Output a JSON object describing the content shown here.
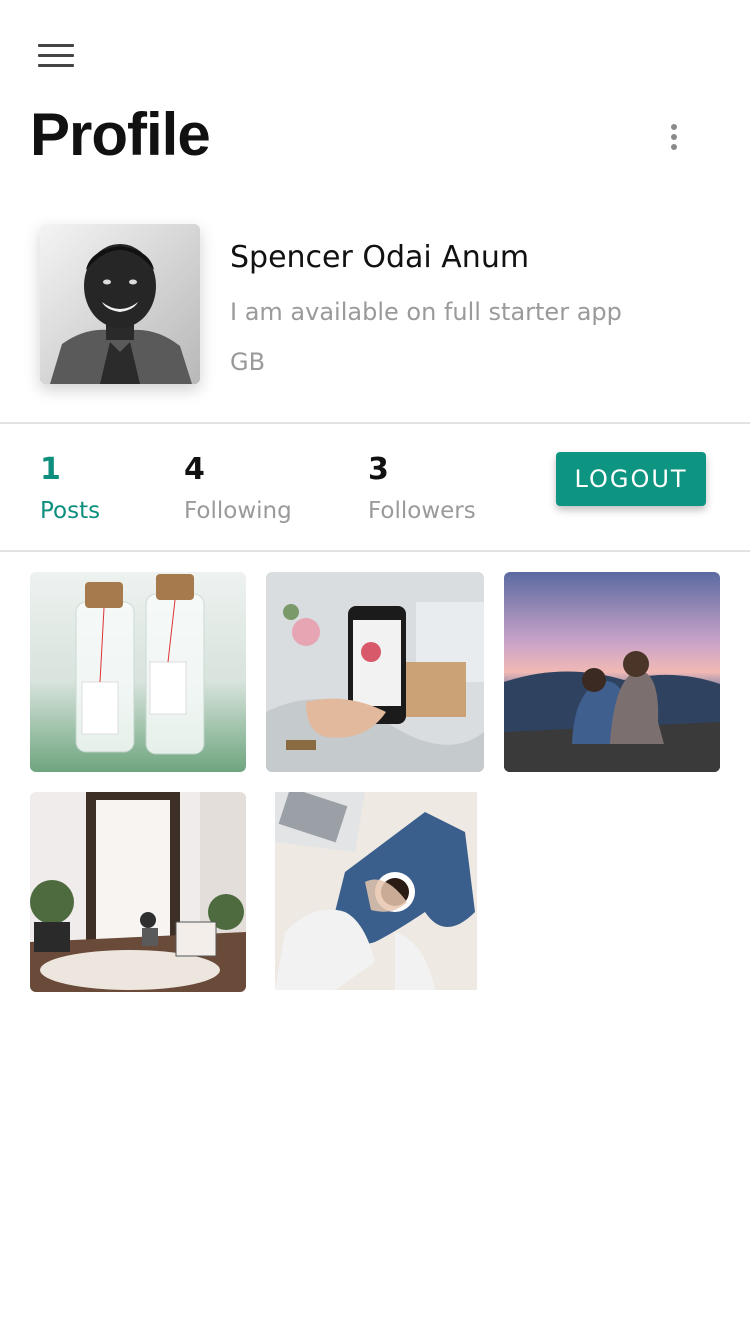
{
  "header": {
    "title": "Profile",
    "menu_icon": "hamburger-menu-icon",
    "more_icon": "more-vertical-icon"
  },
  "profile": {
    "name": "Spencer Odai Anum",
    "bio": "I am available on full starter app",
    "country": "GB"
  },
  "stats": [
    {
      "value": "1",
      "label": "Posts"
    },
    {
      "value": "4",
      "label": "Following"
    },
    {
      "value": "3",
      "label": "Followers"
    }
  ],
  "actions": {
    "logout_label": "LOGOUT"
  },
  "colors": {
    "accent": "#0d9582",
    "muted_text": "#9a9a9a",
    "divider": "#e2e2e2"
  },
  "gallery": [
    {
      "subject": "glass bottles with notes"
    },
    {
      "subject": "phone photographing bed scene"
    },
    {
      "subject": "couple at mountain sunset"
    },
    {
      "subject": "mirror room with plants"
    },
    {
      "subject": "coffee and laptop on blanket"
    }
  ]
}
